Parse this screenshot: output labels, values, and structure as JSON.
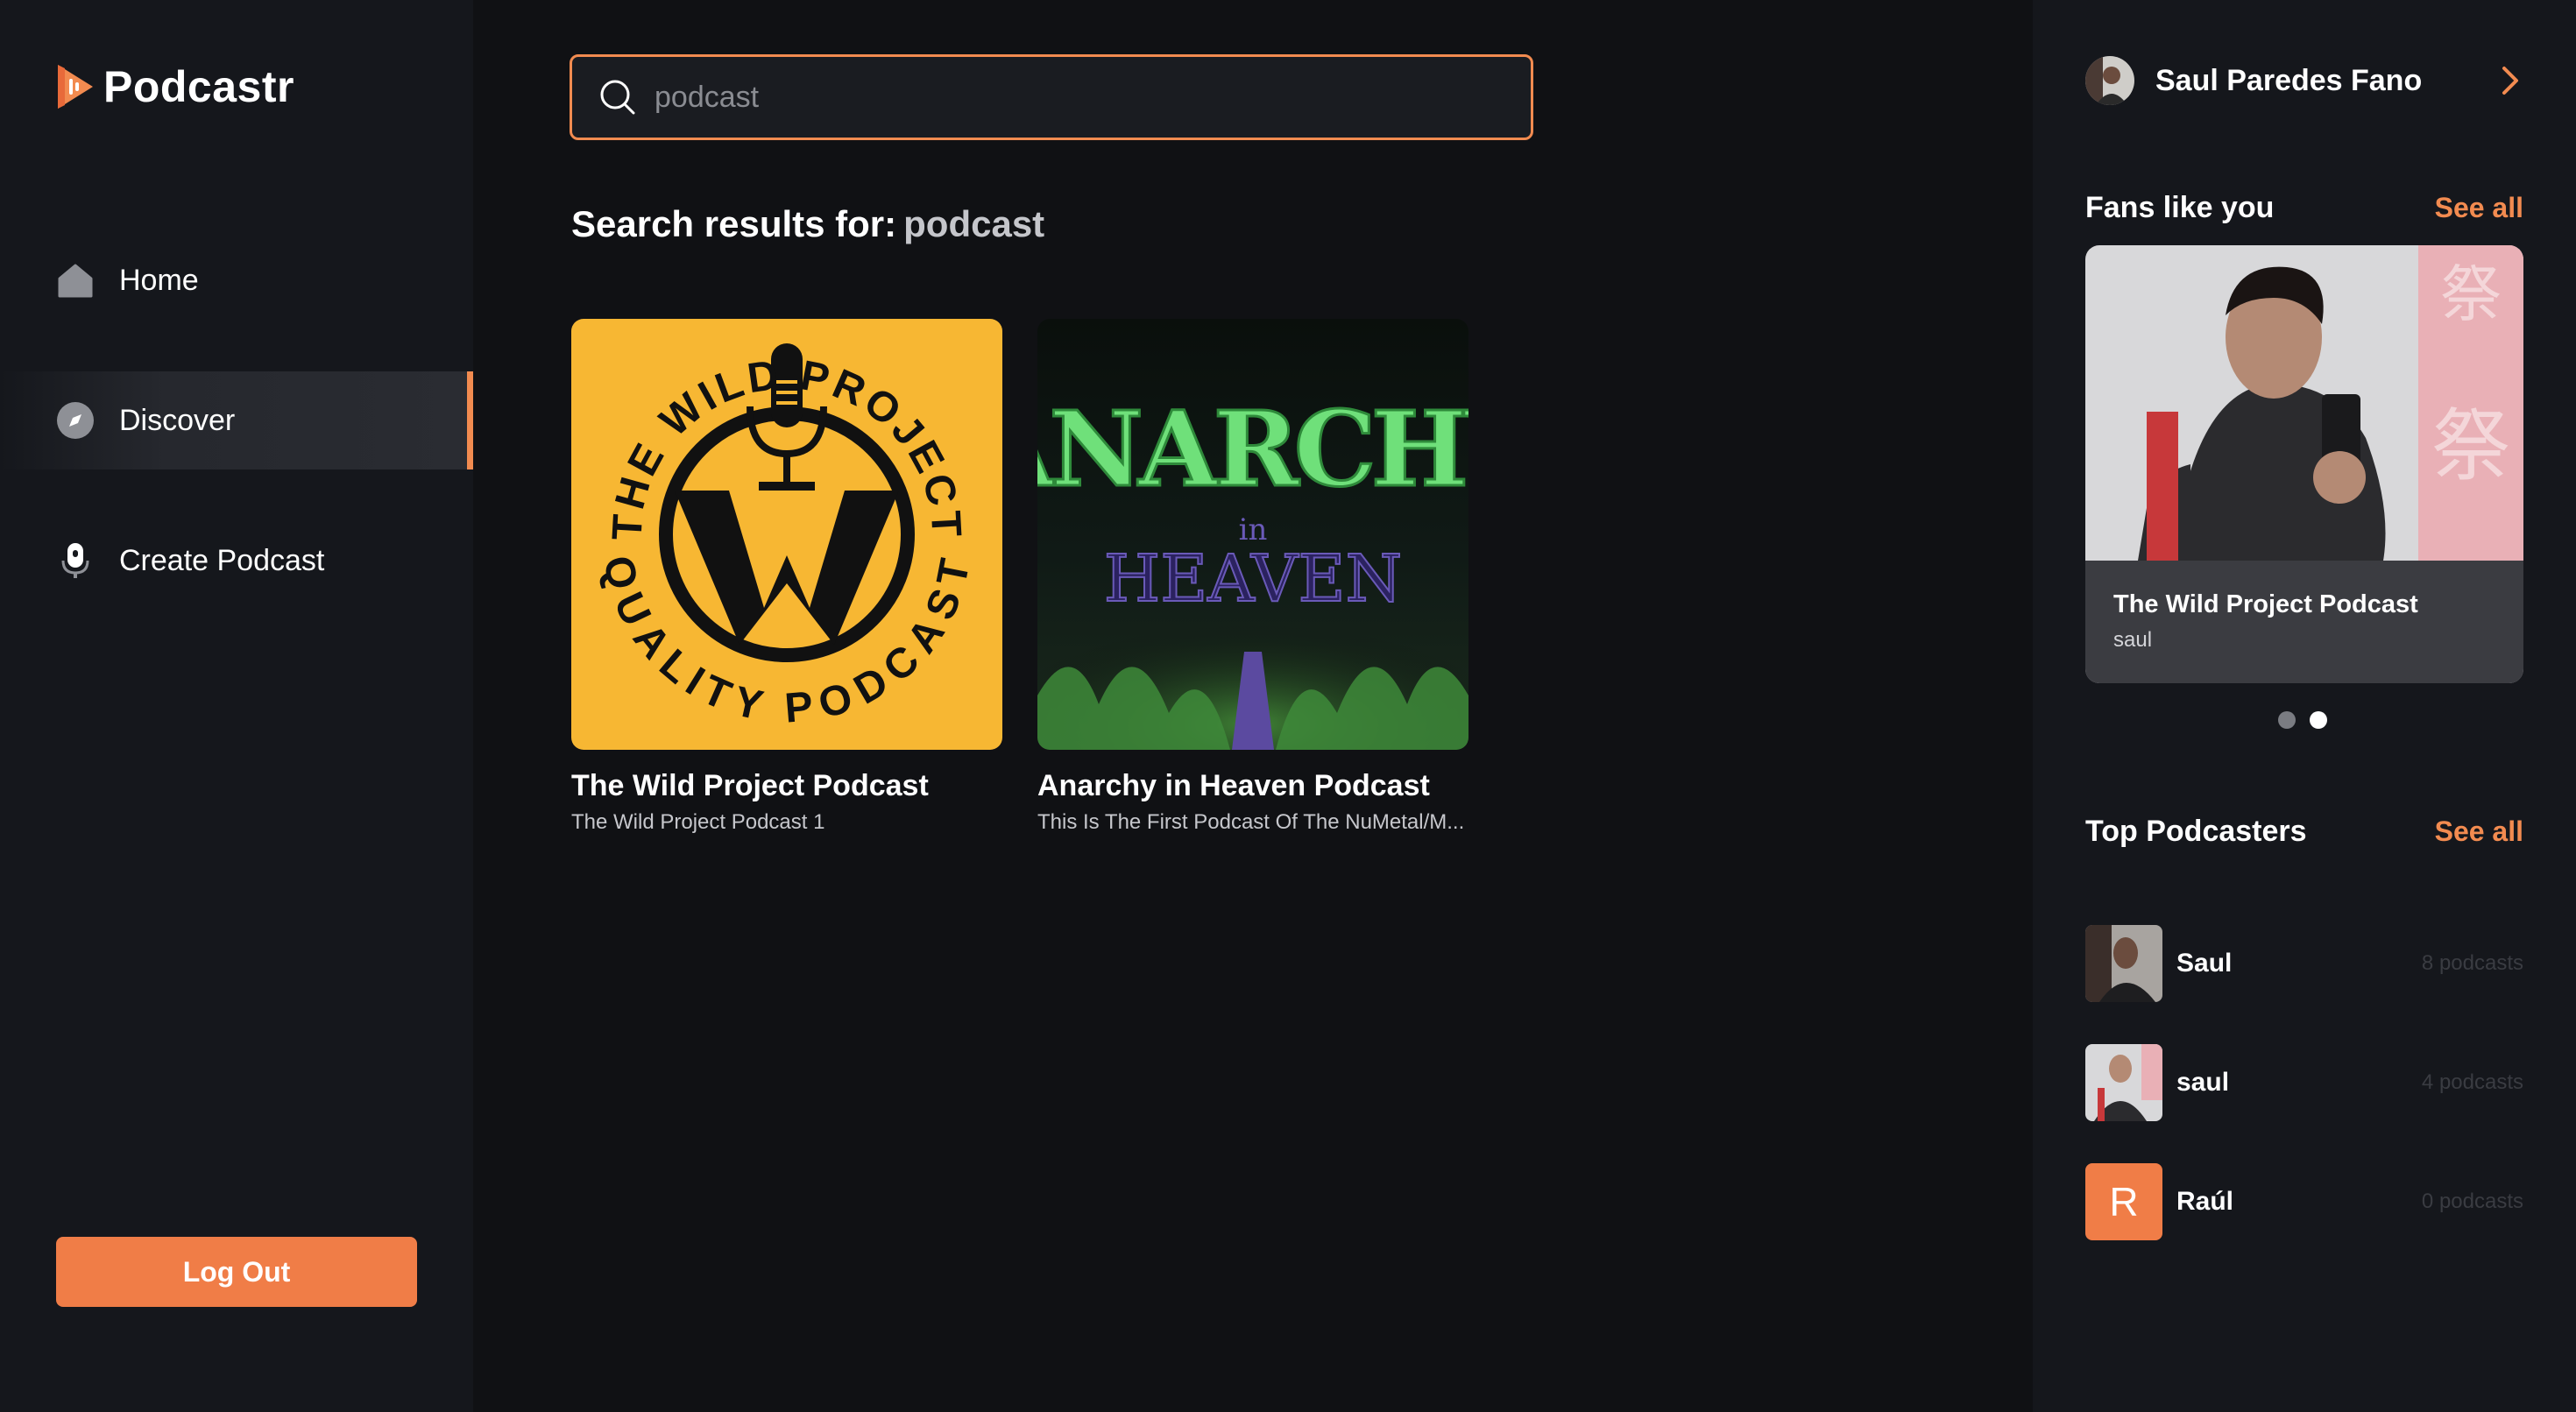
{
  "app": {
    "name": "Podcastr",
    "accent": "#f28b50"
  },
  "sidebar": {
    "items": [
      {
        "label": "Home",
        "icon": "home-icon",
        "active": false
      },
      {
        "label": "Discover",
        "icon": "discover-compass-icon",
        "active": true
      },
      {
        "label": "Create Podcast",
        "icon": "microphone-icon",
        "active": false
      }
    ],
    "logout_label": "Log Out"
  },
  "search": {
    "value": "",
    "placeholder": "podcast"
  },
  "results": {
    "heading_prefix": "Search results for:",
    "query": "podcast",
    "items": [
      {
        "title": "The Wild Project Podcast",
        "description": "The Wild Project Podcast 1",
        "cover_text_top": "THE WILD PROJECT",
        "cover_text_bottom": "QUALITY PODCAST"
      },
      {
        "title": "Anarchy in Heaven Podcast",
        "description": "This Is The First Podcast Of The NuMetal/M...",
        "cover_text_top": "ANARCHY",
        "cover_text_mid": "in",
        "cover_text_bottom": "HEAVEN"
      }
    ]
  },
  "right": {
    "user_name": "Saul Paredes Fano",
    "fans": {
      "title": "Fans like you",
      "see_all": "See all",
      "card_title": "The Wild Project Podcast",
      "card_author": "saul",
      "slide_count": 2,
      "active_slide": 2
    },
    "top_podcasters": {
      "title": "Top Podcasters",
      "see_all": "See all",
      "items": [
        {
          "name": "Saul",
          "count": "8 podcasts",
          "avatar": "photo"
        },
        {
          "name": "saul",
          "count": "4 podcasts",
          "avatar": "photo"
        },
        {
          "name": "Raúl",
          "count": "0 podcasts",
          "avatar": "letter",
          "letter": "R"
        }
      ]
    }
  }
}
